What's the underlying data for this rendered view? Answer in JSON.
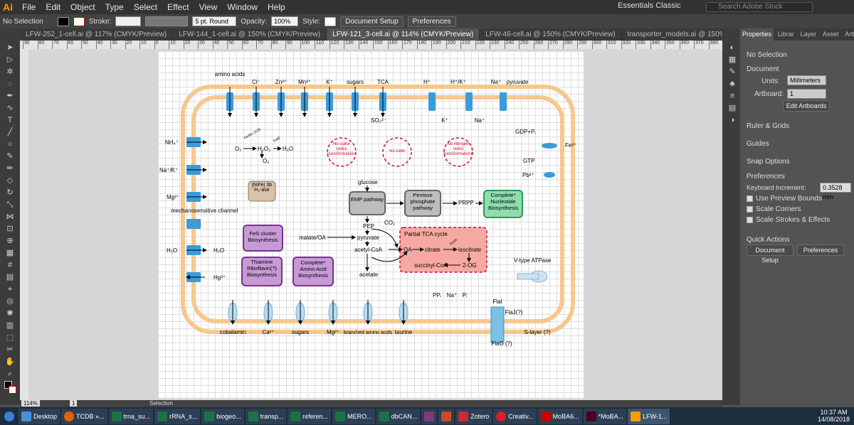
{
  "app": {
    "logo": "Ai",
    "menu": [
      "File",
      "Edit",
      "Object",
      "Type",
      "Select",
      "Effect",
      "View",
      "Window",
      "Help"
    ],
    "workspace": "Essentials Classic",
    "search_placeholder": "Search Adobe Stock"
  },
  "control": {
    "selection": "No Selection",
    "stroke_label": "Stroke:",
    "brush": "5 pt. Round",
    "opacity_label": "Opacity:",
    "opacity": "100%",
    "style_label": "Style:",
    "doc_setup": "Document Setup",
    "prefs": "Preferences"
  },
  "tabs": [
    "LFW-252_1-cell.ai @ 117% (CMYK/Preview)",
    "LFW-144_1-cell.ai @ 150% (CMYK/Preview)",
    "LFW-121_3-cell.ai @ 114% (CMYK/Preview)",
    "LFW-46-cell.ai @ 150% (CMYK/Preview)",
    "transporter_models.ai @ 150% (CMYK/Preview)"
  ],
  "ruler": [
    "90",
    "80",
    "70",
    "60",
    "50",
    "40",
    "30",
    "20",
    "10",
    "0",
    "10",
    "20",
    "30",
    "40",
    "50",
    "60",
    "70",
    "80",
    "90",
    "100",
    "110",
    "120",
    "130",
    "140",
    "150",
    "160",
    "170",
    "180",
    "190",
    "200",
    "210",
    "220",
    "230",
    "240",
    "250",
    "260",
    "270",
    "280",
    "290",
    "300",
    "310",
    "320",
    "330",
    "340",
    "350",
    "360",
    "370",
    "380"
  ],
  "diagram": {
    "top_labels": [
      "amino acids",
      "Cl⁻",
      "Zn²⁺",
      "Mn²⁺",
      "K⁺",
      "sugars",
      "TCA",
      "H⁺",
      "H⁺/K⁺",
      "Na⁺",
      "pyruvate"
    ],
    "below_top": [
      "SO₃²⁻",
      "K⁺",
      "Na⁺"
    ],
    "left_labels": [
      "NH₄⁺",
      "Na⁺/K⁺",
      "Mg²⁺",
      "mechanosensitive channel",
      "H₂O",
      "H₂O",
      "Hg²⁺"
    ],
    "bottom_labels": [
      "cobalamin",
      "Ca²⁺",
      "sugars",
      "Mg²⁺",
      "branched amino acids",
      "taurine",
      "PPᵢ",
      "Na⁺",
      "Pᵢ",
      "FlaI",
      "FlaJ(?)",
      "S-layer (?)",
      "FlaG (?)"
    ],
    "right_labels": [
      "GDP+Pᵢ",
      "GTP",
      "Fe²⁺",
      "Pb²⁺",
      "V-type ATPase"
    ],
    "ros": {
      "o2": "O₂",
      "h2o2": "H₂O₂",
      "h2o": "H₂O",
      "o2b": "O₂",
      "sod": "Fe/Mn SOD",
      "cat": "KatE"
    },
    "circles": [
      "No sulfur redox transformations",
      "No CBB",
      "No nitrogen redox transformations"
    ],
    "boxes": {
      "nife": "[NiFe] 3b H₂-ase",
      "emp": "EMP pathway",
      "ppp": "Pentose phosphate pathway",
      "nuc": "Complete* Nucleotide Biosynthesis",
      "fes": "FeS cluster Biosynthesis",
      "thia": "Thiamine Riboflavin(?) Biosynthesis",
      "aa": "Complete* Amino Acid Biosynthesis",
      "tca": "Partial TCA cycle"
    },
    "metab": [
      "glucose",
      "PRPP",
      "PEP",
      "CO₂",
      "pyruvate",
      "malate/OA",
      "acetyl-CoA",
      "acetate",
      "OA",
      "citrate",
      "isocitrate",
      "succinyl-CoA",
      "2-OG",
      "AcnA"
    ]
  },
  "panel": {
    "tabs": [
      "Properties",
      "Librar",
      "Layer",
      "Asset",
      "Artbo"
    ],
    "nosel": "No Selection",
    "document": "Document",
    "units_label": "Units:",
    "units": "Millimeters",
    "artboard_label": "Artboard:",
    "artboard": "1",
    "edit_artboards": "Edit Artboards",
    "rulers": "Ruler & Grids",
    "guides": "Guides",
    "snap": "Snap Options",
    "preferences": "Preferences",
    "kb_label": "Keyboard Increment:",
    "kb": "0.3528 mm",
    "opt1": "Use Preview Bounds",
    "opt2": "Scale Corners",
    "opt3": "Scale Strokes & Effects",
    "quick": "Quick Actions",
    "qa1": "Document Setup",
    "qa2": "Preferences"
  },
  "status": {
    "zoom": "114%",
    "page": "1",
    "tool": "Selection"
  },
  "taskbar": {
    "items": [
      "Desktop",
      "TCDB »...",
      "trna_su...",
      "rRNA_s...",
      "biogeo...",
      "transp...",
      "referen...",
      "MERO...",
      "dbCAN...",
      "",
      "",
      "Zotero",
      "Creativ...",
      "MoBA6...",
      "*MoBA...",
      "LFW-1..."
    ],
    "time": "10:37 AM",
    "date": "14/08/2018"
  }
}
